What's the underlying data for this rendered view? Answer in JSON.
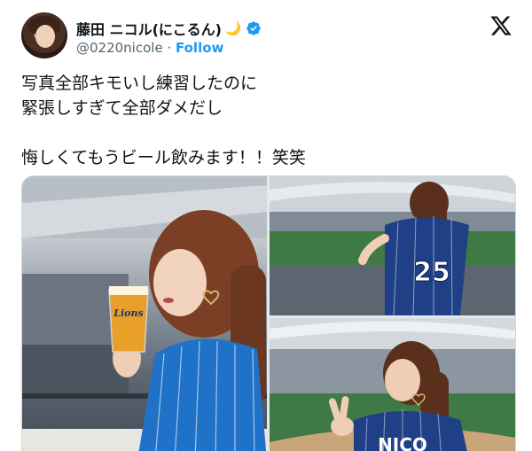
{
  "header": {
    "display_name": "藤田 ニコル(にこるん)",
    "moon_glyph": "🌙",
    "handle": "@0220nicole",
    "separator": " · ",
    "follow_label": "Follow"
  },
  "tweet": {
    "line1": "写真全部キモいし練習したのに",
    "line2": "緊張しすぎて全部ダメだし",
    "line3": "悔しくてもうビール飲みます！！笑笑"
  },
  "media": {
    "cup_label": "Lions",
    "jersey_number": "25",
    "jersey_name": "NICO"
  },
  "icons": {
    "verified": "verified-badge-icon",
    "x_logo": "x-logo-icon"
  },
  "colors": {
    "link": "#1d9bf0",
    "text": "#0f1419",
    "muted": "#536471",
    "jersey_blue": "#1f72c7"
  }
}
